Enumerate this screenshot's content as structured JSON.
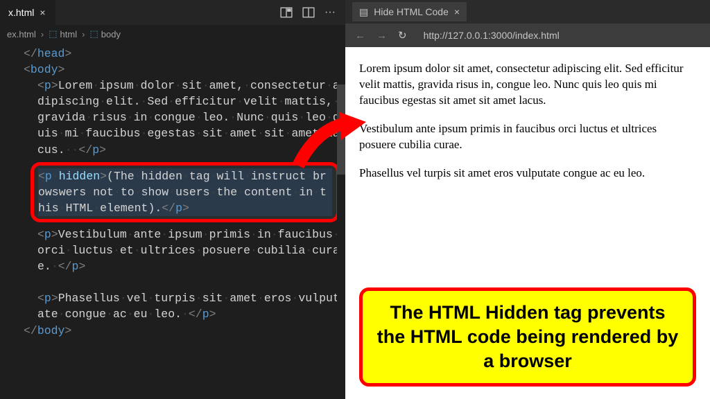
{
  "editor": {
    "tab_name": "x.html",
    "breadcrumb": {
      "file": "ex.html",
      "path1": "html",
      "path2": "body"
    },
    "code": {
      "head_close": "</head>",
      "body_open": "<body>",
      "p1_open": "<p>",
      "p1_text": "Lorem ipsum dolor sit amet, consectetur adipiscing elit. Sed efficitur velit mattis, gravida risus in congue leo. Nunc quis leo quis mi faucibus egestas sit amet sit amet lacus.  ",
      "p1_close": "</p>",
      "hidden_open_tag": "<p",
      "hidden_attr": " hidden",
      "hidden_open_end": ">",
      "hidden_text": "(The hidden tag will instruct browswers not to show users the content in this HTML element).",
      "hidden_close": "</p>",
      "p3_open": "<p>",
      "p3_text": "Vestibulum ante ipsum primis in faucibus orci luctus et ultrices posuere cubilia curae. ",
      "p3_close": "</p>",
      "p4_open": "<p>",
      "p4_text": "Phasellus vel turpis sit amet eros vulputate congue ac eu leo. ",
      "p4_close": "</p>",
      "body_close": "</body>"
    }
  },
  "browser": {
    "tab_title": "Hide HTML Code",
    "url": "http://127.0.0.1:3000/index.html",
    "para1": "Lorem ipsum dolor sit amet, consectetur adipiscing elit. Sed efficitur velit mattis, gravida risus in, congue leo. Nunc quis leo quis mi faucibus egestas sit amet sit amet lacus.",
    "para2": "Vestibulum ante ipsum primis in faucibus orci luctus et ultrices posuere cubilia curae.",
    "para3": "Phasellus vel turpis sit amet eros vulputate congue ac eu leo."
  },
  "callout_text": "The HTML Hidden tag prevents the HTML code being rendered by a browser"
}
